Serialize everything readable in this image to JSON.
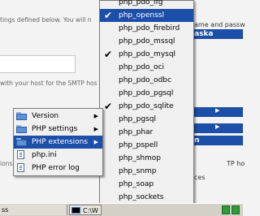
{
  "background": {
    "line1": "tings defined below. You will n",
    "line2": "with your host for the SMTP hos",
    "line3": "ions",
    "right_line1": "ame and passw",
    "right_heading": "aska",
    "right_line2": "n",
    "right_line3": "ces",
    "right_line4": "TP ho"
  },
  "extensions_menu": {
    "items": [
      {
        "label": "php_pdo_ifg",
        "checked": false
      },
      {
        "label": "php_openssl",
        "checked": true
      },
      {
        "label": "php_pdo_firebird",
        "checked": false
      },
      {
        "label": "php_pdo_mssql",
        "checked": false
      },
      {
        "label": "php_pdo_mysql",
        "checked": true
      },
      {
        "label": "php_pdo_oci",
        "checked": false
      },
      {
        "label": "php_pdo_odbc",
        "checked": false
      },
      {
        "label": "php_pdo_pgsql",
        "checked": false
      },
      {
        "label": "php_pdo_sqlite",
        "checked": true
      },
      {
        "label": "php_pgsql",
        "checked": false
      },
      {
        "label": "php_phar",
        "checked": false
      },
      {
        "label": "php_pspell",
        "checked": false
      },
      {
        "label": "php_shmop",
        "checked": false
      },
      {
        "label": "php_snmp",
        "checked": false
      },
      {
        "label": "php_soap",
        "checked": false
      },
      {
        "label": "php_sockets",
        "checked": false
      }
    ],
    "selected": "php_openssl"
  },
  "php_menu": {
    "items": [
      {
        "label": "Version",
        "icon": "folder-icon",
        "submenu": true
      },
      {
        "label": "PHP settings",
        "icon": "folder-icon",
        "submenu": true
      },
      {
        "label": "PHP extensions",
        "icon": "folder-icon",
        "submenu": true
      },
      {
        "label": "php.ini",
        "icon": "document-icon",
        "submenu": false
      },
      {
        "label": "PHP error log",
        "icon": "document-icon",
        "submenu": false
      }
    ],
    "selected": "PHP extensions"
  },
  "taskbar": {
    "left_text": "ss",
    "cmd_label": "C:\\W"
  },
  "colors": {
    "highlight": "#1c4fa8",
    "menu_bg": "#f0f0f0"
  }
}
